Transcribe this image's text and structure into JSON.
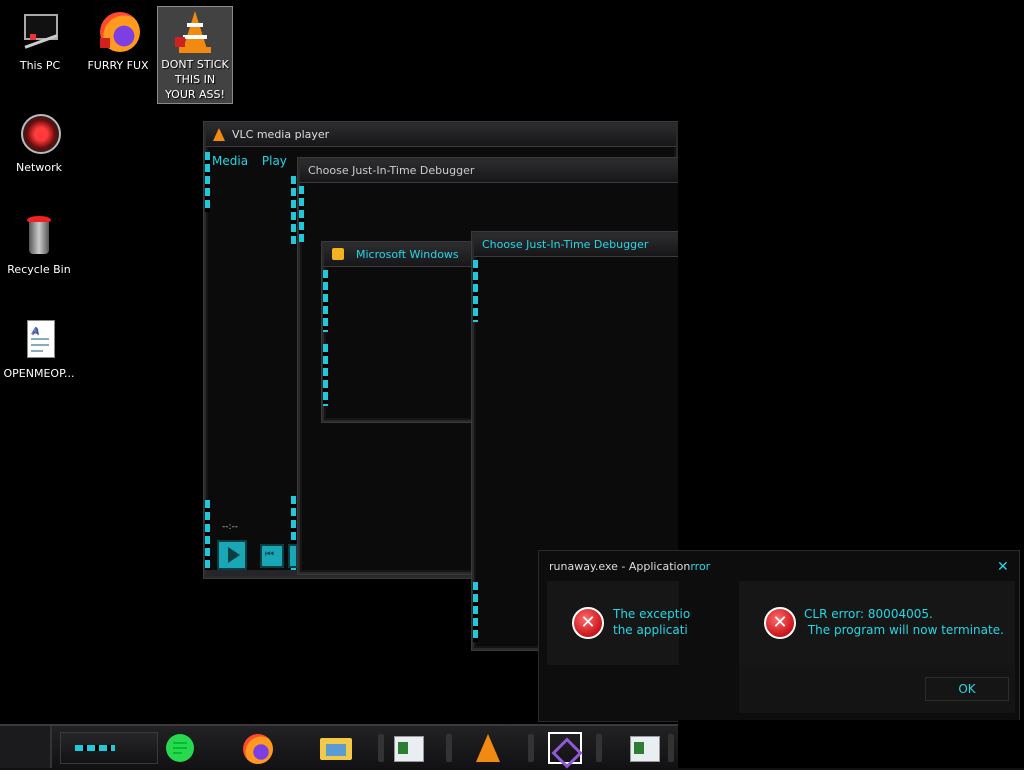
{
  "desktop": {
    "icons": [
      {
        "label": "This PC"
      },
      {
        "label": "FURRY FUX"
      },
      {
        "label": "DONT STICK THIS IN YOUR ASS!"
      },
      {
        "label": "Network"
      },
      {
        "label": "Recycle Bin"
      },
      {
        "label": "OPENMEOP..."
      }
    ]
  },
  "windows": {
    "vlc": {
      "title": "VLC media player",
      "menu": [
        "Media",
        "Play"
      ],
      "time": "--:--"
    },
    "jit1": {
      "title": "Choose Just-In-Time Debugger"
    },
    "mswin": {
      "title": "Microsoft Windows"
    },
    "jit2": {
      "title": "Choose Just-In-Time Debugger"
    }
  },
  "error_dialog": {
    "title_left": "runaway.exe - Application",
    "title_right": "rror",
    "left_line1": "The exceptio",
    "left_line2": "the applicati",
    "right_line1": "CLR error: 80004005.",
    "right_line2": " The program will now terminate.",
    "ok_label": "OK",
    "close_glyph": "✕"
  },
  "colors": {
    "accent": "#25d6e6",
    "error": "#c8141a"
  }
}
